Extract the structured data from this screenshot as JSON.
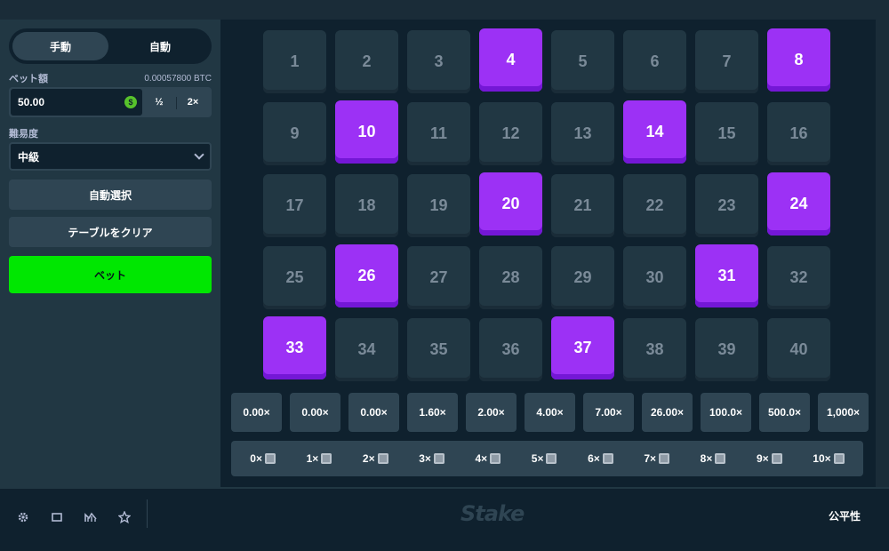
{
  "sidebar": {
    "mode_tabs": [
      {
        "label": "手動",
        "active": true
      },
      {
        "label": "自動",
        "active": false
      }
    ],
    "bet_amount_label": "ベット額",
    "bet_amount_crypto": "0.00057800 BTC",
    "bet_amount_value": "50.00",
    "currency_icon": "dollar-coin-icon",
    "half_label": "½",
    "double_label": "2×",
    "difficulty_label": "難易度",
    "difficulty_value": "中級",
    "auto_pick_label": "自動選択",
    "clear_table_label": "テーブルをクリア",
    "bet_button_label": "ベット"
  },
  "board": {
    "tiles": [
      {
        "n": "1",
        "selected": false
      },
      {
        "n": "2",
        "selected": false
      },
      {
        "n": "3",
        "selected": false
      },
      {
        "n": "4",
        "selected": true
      },
      {
        "n": "5",
        "selected": false
      },
      {
        "n": "6",
        "selected": false
      },
      {
        "n": "7",
        "selected": false
      },
      {
        "n": "8",
        "selected": true
      },
      {
        "n": "9",
        "selected": false
      },
      {
        "n": "10",
        "selected": true
      },
      {
        "n": "11",
        "selected": false
      },
      {
        "n": "12",
        "selected": false
      },
      {
        "n": "13",
        "selected": false
      },
      {
        "n": "14",
        "selected": true
      },
      {
        "n": "15",
        "selected": false
      },
      {
        "n": "16",
        "selected": false
      },
      {
        "n": "17",
        "selected": false
      },
      {
        "n": "18",
        "selected": false
      },
      {
        "n": "19",
        "selected": false
      },
      {
        "n": "20",
        "selected": true
      },
      {
        "n": "21",
        "selected": false
      },
      {
        "n": "22",
        "selected": false
      },
      {
        "n": "23",
        "selected": false
      },
      {
        "n": "24",
        "selected": true
      },
      {
        "n": "25",
        "selected": false
      },
      {
        "n": "26",
        "selected": true
      },
      {
        "n": "27",
        "selected": false
      },
      {
        "n": "28",
        "selected": false
      },
      {
        "n": "29",
        "selected": false
      },
      {
        "n": "30",
        "selected": false
      },
      {
        "n": "31",
        "selected": true
      },
      {
        "n": "32",
        "selected": false
      },
      {
        "n": "33",
        "selected": true
      },
      {
        "n": "34",
        "selected": false
      },
      {
        "n": "35",
        "selected": false
      },
      {
        "n": "36",
        "selected": false
      },
      {
        "n": "37",
        "selected": true
      },
      {
        "n": "38",
        "selected": false
      },
      {
        "n": "39",
        "selected": false
      },
      {
        "n": "40",
        "selected": false
      }
    ],
    "multipliers": [
      "0.00×",
      "0.00×",
      "0.00×",
      "1.60×",
      "2.00×",
      "4.00×",
      "7.00×",
      "26.00×",
      "100.0×",
      "500.0×",
      "1,000×"
    ],
    "hits": [
      "0×",
      "1×",
      "2×",
      "3×",
      "4×",
      "5×",
      "6×",
      "7×",
      "8×",
      "9×",
      "10×"
    ],
    "hit_icon": "gem-icon"
  },
  "footer": {
    "icons": [
      "gear-icon",
      "square-icon",
      "chart-icon",
      "star-icon"
    ],
    "logo_text": "Stake",
    "fairness_label": "公平性"
  },
  "colors": {
    "selected_tile": "#9c31f5",
    "bet_button": "#00e701",
    "background": "#0f212e",
    "panel": "#213743"
  }
}
